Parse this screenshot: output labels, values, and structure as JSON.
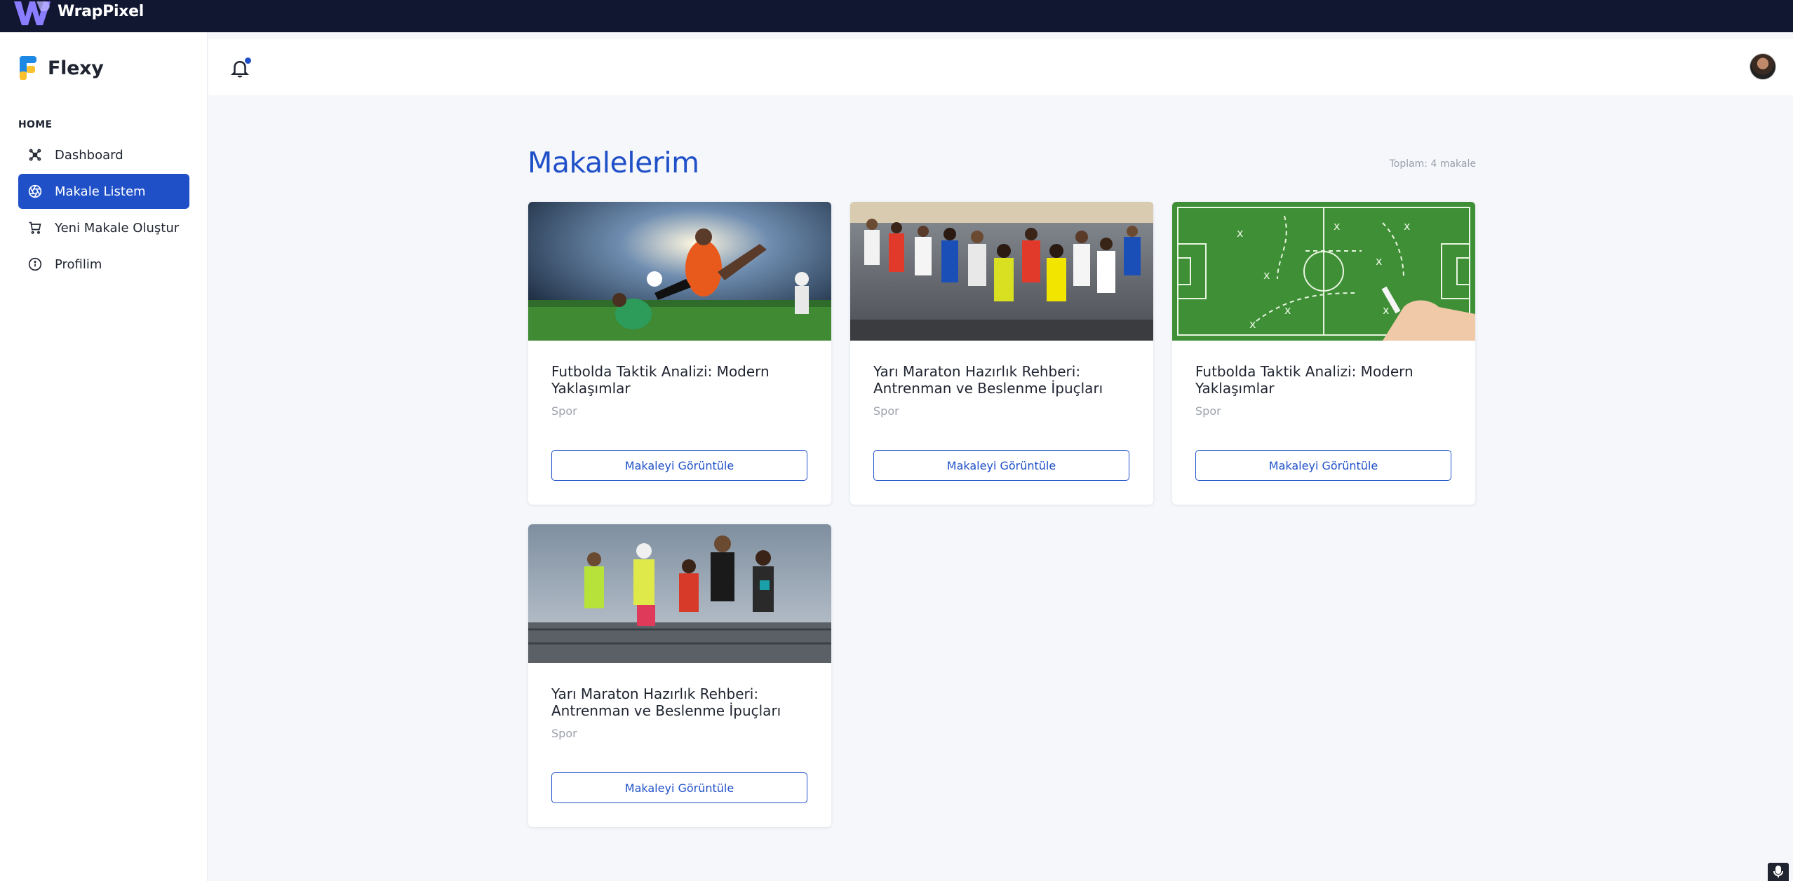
{
  "topbar": {
    "brand": "WrapPixel"
  },
  "sidebar": {
    "brand": "Flexy",
    "caption": "HOME",
    "items": [
      {
        "label": "Dashboard",
        "icon": "dashboard-icon",
        "active": false
      },
      {
        "label": "Makale Listem",
        "icon": "aperture-icon",
        "active": true
      },
      {
        "label": "Yeni Makale Oluştur",
        "icon": "cart-icon",
        "active": false
      },
      {
        "label": "Profilim",
        "icon": "info-icon",
        "active": false
      }
    ]
  },
  "header": {
    "notification_icon": "bell-icon",
    "has_notification": true,
    "avatar": "user-avatar"
  },
  "main": {
    "title": "Makalelerim",
    "total": "Toplam: 4 makale",
    "cards": [
      {
        "title": "Futbolda Taktik Analizi: Modern Yaklaşımlar",
        "category": "Spor",
        "button": "Makaleyi Görüntüle",
        "image": "football-players-photo"
      },
      {
        "title": "Yarı Maraton Hazırlık Rehberi: Antrenman ve Beslenme İpuçları",
        "category": "Spor",
        "button": "Makaleyi Görüntüle",
        "image": "marathon-crowd-photo"
      },
      {
        "title": "Futbolda Taktik Analizi: Modern Yaklaşımlar",
        "category": "Spor",
        "button": "Makaleyi Görüntüle",
        "image": "tactics-board-photo"
      },
      {
        "title": "Yarı Maraton Hazırlık Rehberi: Antrenman ve Beslenme İpuçları",
        "category": "Spor",
        "button": "Makaleyi Görüntüle",
        "image": "runners-photo"
      }
    ]
  },
  "colors": {
    "primary": "#2050c8",
    "topbar": "#111631",
    "background": "#f5f7fb"
  }
}
